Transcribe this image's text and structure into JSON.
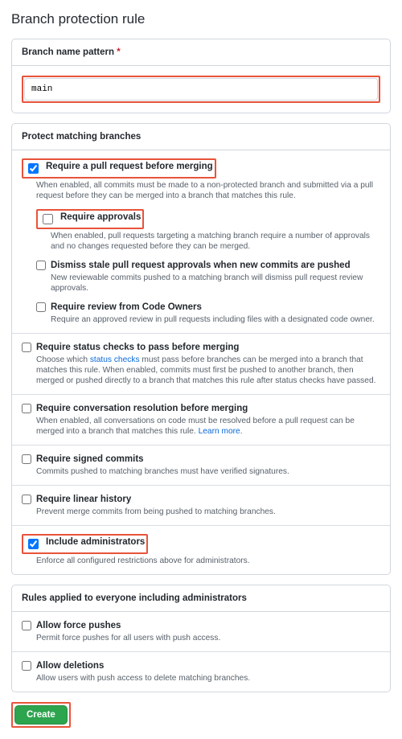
{
  "page_title": "Branch protection rule",
  "pattern": {
    "header": "Branch name pattern",
    "value": "main"
  },
  "protect": {
    "header": "Protect matching branches",
    "require_pr": {
      "label": "Require a pull request before merging",
      "desc": "When enabled, all commits must be made to a non-protected branch and submitted via a pull request before they can be merged into a branch that matches this rule.",
      "checked": true
    },
    "require_approvals": {
      "label": "Require approvals",
      "desc": "When enabled, pull requests targeting a matching branch require a number of approvals and no changes requested before they can be merged.",
      "checked": false
    },
    "dismiss_stale": {
      "label": "Dismiss stale pull request approvals when new commits are pushed",
      "desc": "New reviewable commits pushed to a matching branch will dismiss pull request review approvals.",
      "checked": false
    },
    "code_owners": {
      "label": "Require review from Code Owners",
      "desc": "Require an approved review in pull requests including files with a designated code owner.",
      "checked": false
    },
    "status_checks": {
      "label": "Require status checks to pass before merging",
      "desc_pre": "Choose which ",
      "link": "status checks",
      "desc_post": " must pass before branches can be merged into a branch that matches this rule. When enabled, commits must first be pushed to another branch, then merged or pushed directly to a branch that matches this rule after status checks have passed.",
      "checked": false
    },
    "conversation": {
      "label": "Require conversation resolution before merging",
      "desc": "When enabled, all conversations on code must be resolved before a pull request can be merged into a branch that matches this rule. ",
      "link": "Learn more",
      "checked": false
    },
    "signed": {
      "label": "Require signed commits",
      "desc": "Commits pushed to matching branches must have verified signatures.",
      "checked": false
    },
    "linear": {
      "label": "Require linear history",
      "desc": "Prevent merge commits from being pushed to matching branches.",
      "checked": false
    },
    "include_admins": {
      "label": "Include administrators",
      "desc": "Enforce all configured restrictions above for administrators.",
      "checked": true
    }
  },
  "everyone": {
    "header": "Rules applied to everyone including administrators",
    "force_push": {
      "label": "Allow force pushes",
      "desc": "Permit force pushes for all users with push access.",
      "checked": false
    },
    "deletions": {
      "label": "Allow deletions",
      "desc": "Allow users with push access to delete matching branches.",
      "checked": false
    }
  },
  "create_button": "Create"
}
